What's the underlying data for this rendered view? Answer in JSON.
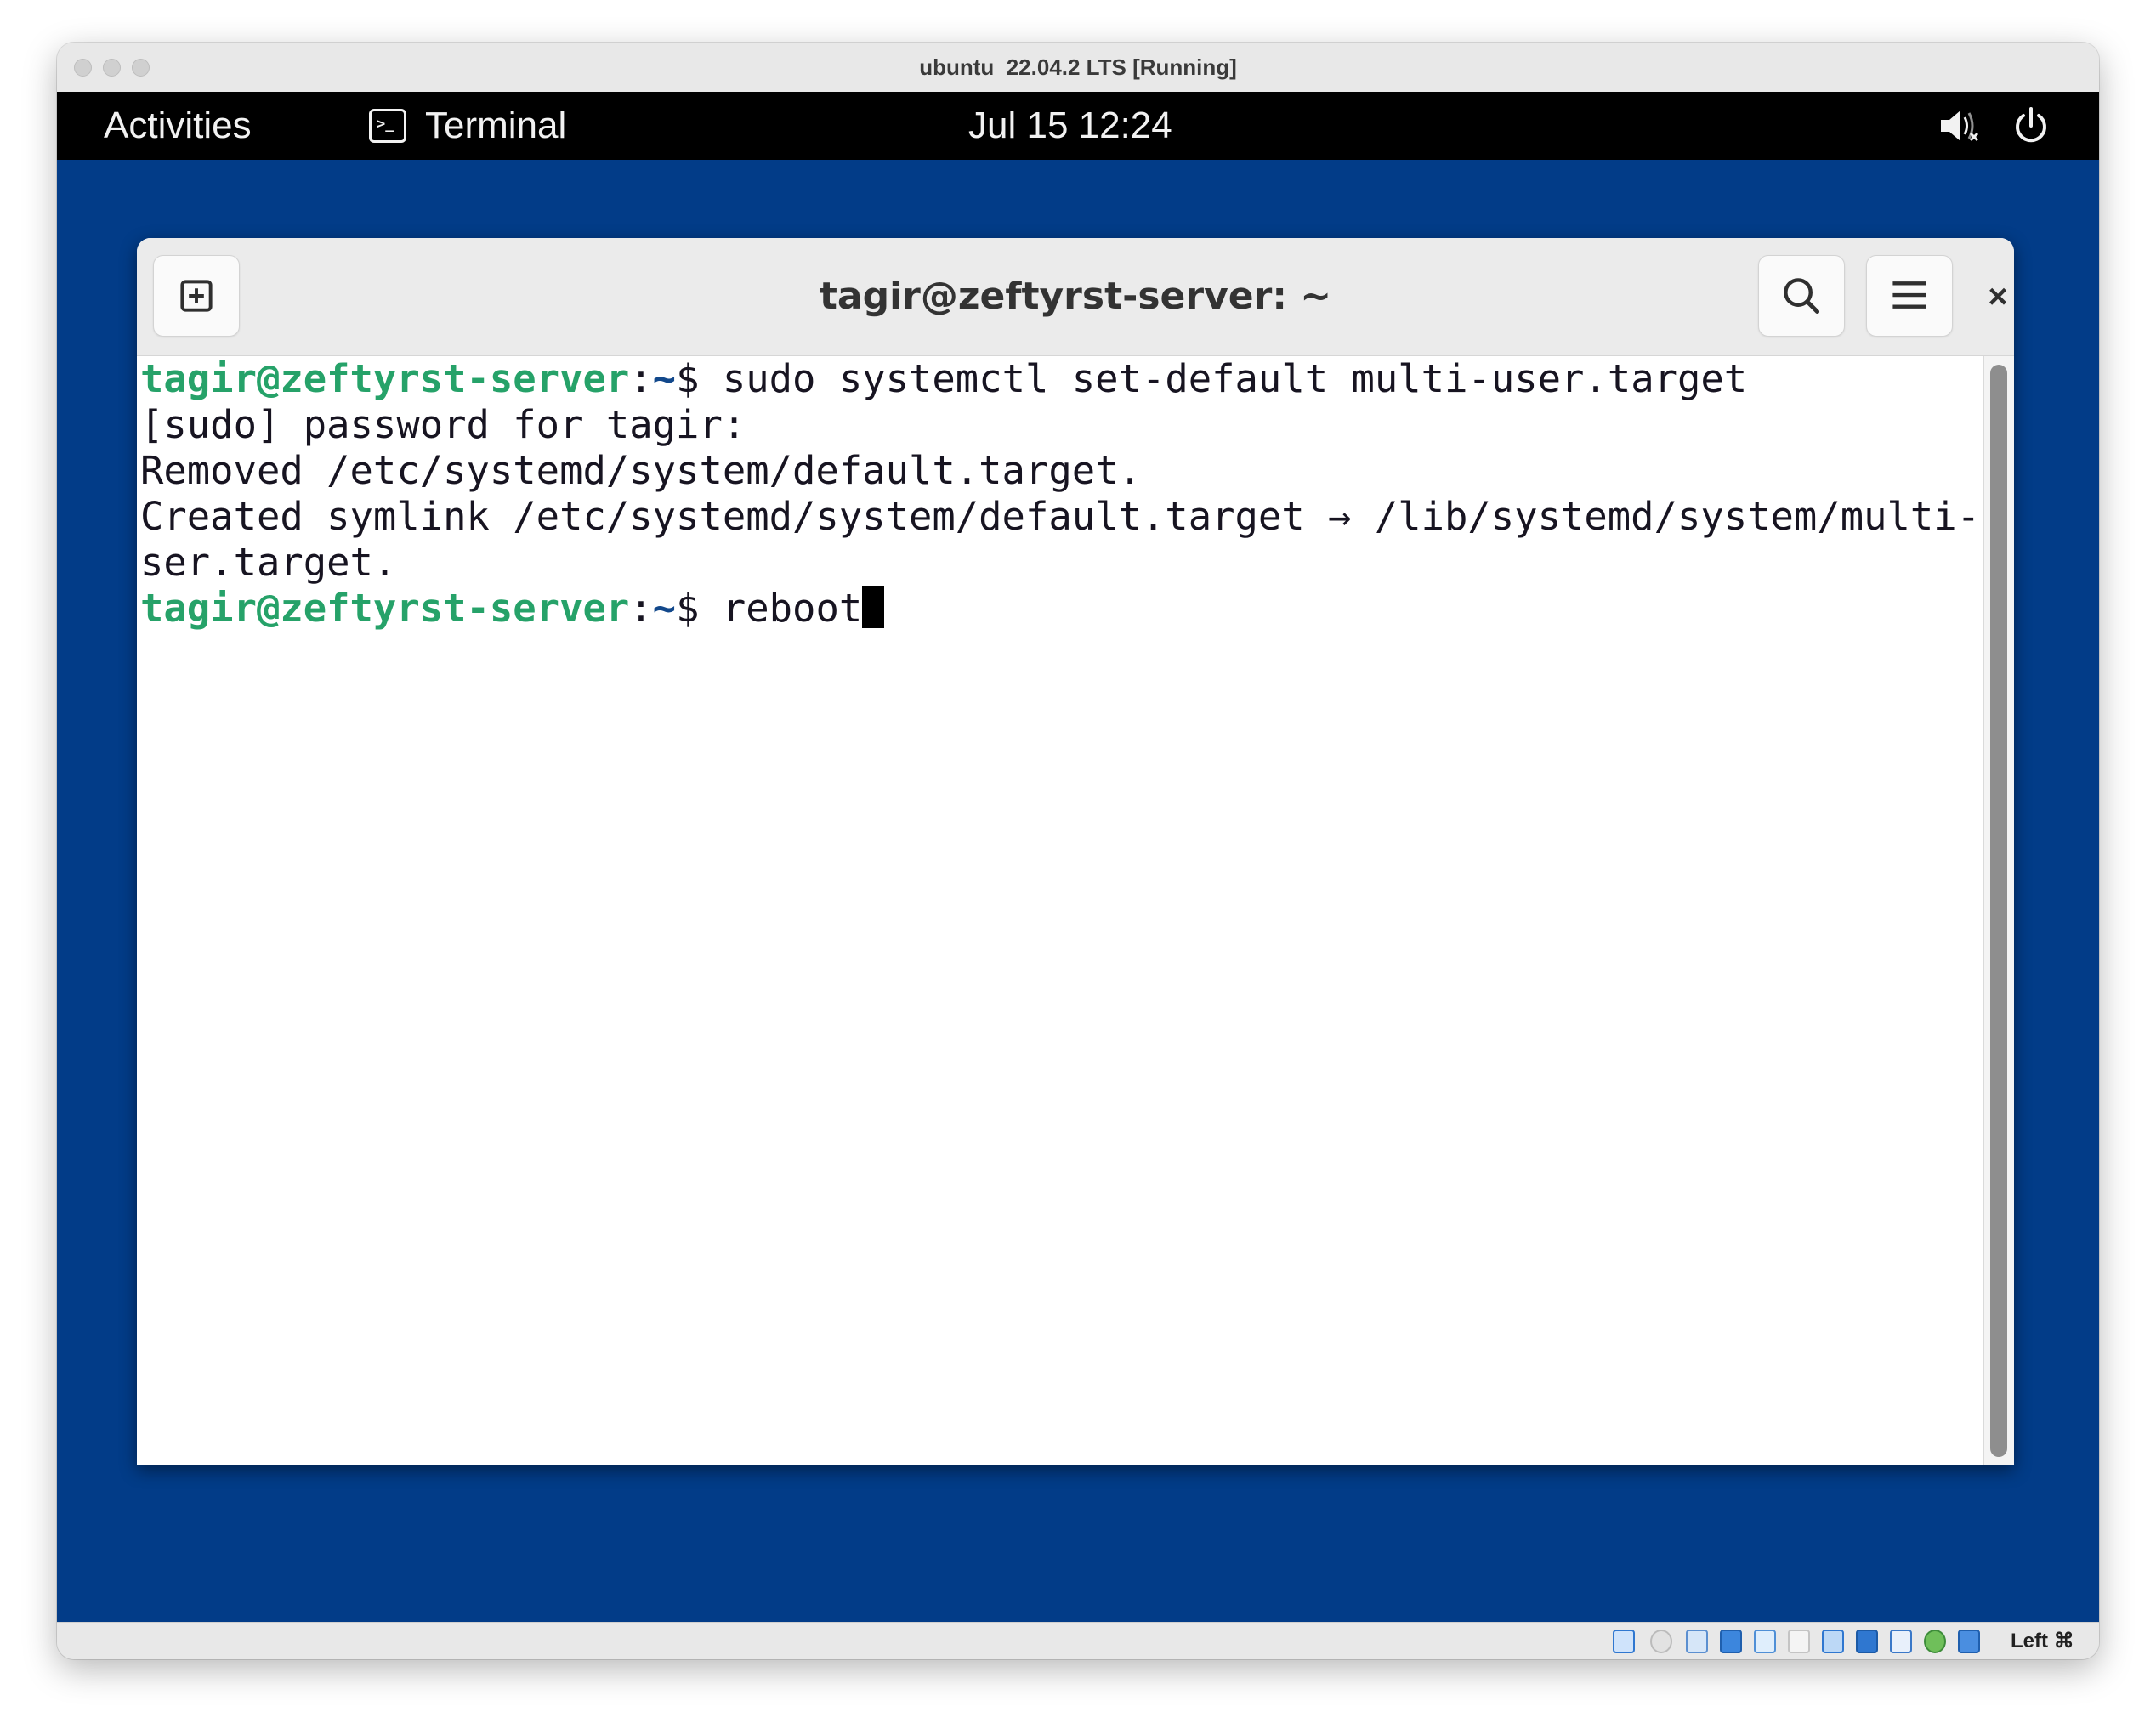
{
  "vm": {
    "title": "ubuntu_22.04.2 LTS [Running]",
    "host_key_label": "Left ⌘"
  },
  "topbar": {
    "activities": "Activities",
    "app_name": "Terminal",
    "app_icon_glyph": ">_",
    "clock": "Jul 15  12:24",
    "icons": [
      "volume-muted-icon",
      "power-icon"
    ]
  },
  "terminal": {
    "title": "tagir@zeftyrst-server: ~",
    "header_buttons": [
      "new-tab-icon",
      "search-icon",
      "hamburger-menu-icon",
      "close-icon"
    ],
    "close_glyph": "×",
    "lines": [
      {
        "user": "tagir@zeftyrst-server",
        "sep": ":",
        "path": "~",
        "prompt": "$ ",
        "text": "sudo systemctl set-default multi-user.target"
      },
      {
        "text": "[sudo] password for tagir:"
      },
      {
        "text": "Removed /etc/systemd/system/default.target."
      },
      {
        "text": "Created symlink /etc/systemd/system/default.target → /lib/systemd/system/multi-u"
      },
      {
        "text": "ser.target."
      },
      {
        "user": "tagir@zeftyrst-server",
        "sep": ":",
        "path": "~",
        "prompt": "$ ",
        "text": "reboot"
      }
    ],
    "colors": {
      "prompt_user": "#26a269",
      "prompt_path": "#12488b",
      "text": "#171421",
      "desktop": "#023c88"
    }
  },
  "statusbar_icons": [
    "hard-disk-icon",
    "optical-disk-icon",
    "audio-icon",
    "network-icon",
    "usb-icon",
    "shared-folders-icon",
    "display-icon",
    "screen-capture-icon",
    "recording-icon",
    "cpu-icon",
    "mouse-integration-icon",
    "download-icon"
  ]
}
